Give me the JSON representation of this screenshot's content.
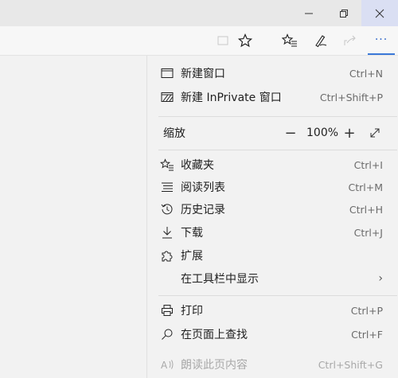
{
  "menu": {
    "new_window": {
      "label": "新建窗口",
      "shortcut": "Ctrl+N"
    },
    "new_private": {
      "label": "新建 InPrivate 窗口",
      "shortcut": "Ctrl+Shift+P"
    },
    "zoom": {
      "label": "缩放",
      "minus": "−",
      "value": "100%",
      "plus": "+"
    },
    "favorites": {
      "label": "收藏夹",
      "shortcut": "Ctrl+I"
    },
    "reading_list": {
      "label": "阅读列表",
      "shortcut": "Ctrl+M"
    },
    "history": {
      "label": "历史记录",
      "shortcut": "Ctrl+H"
    },
    "downloads": {
      "label": "下载",
      "shortcut": "Ctrl+J"
    },
    "extensions": {
      "label": "扩展"
    },
    "show_in_toolbar": {
      "label": "在工具栏中显示",
      "chevron": "›"
    },
    "print": {
      "label": "打印",
      "shortcut": "Ctrl+P"
    },
    "find": {
      "label": "在页面上查找",
      "shortcut": "Ctrl+F"
    },
    "read_aloud": {
      "label": "朗读此页内容",
      "shortcut": "Ctrl+Shift+G"
    }
  },
  "toolbar": {
    "more_glyph": "···"
  },
  "colors": {
    "accent": "#3a78d8",
    "close_hover": "#dadff3"
  }
}
